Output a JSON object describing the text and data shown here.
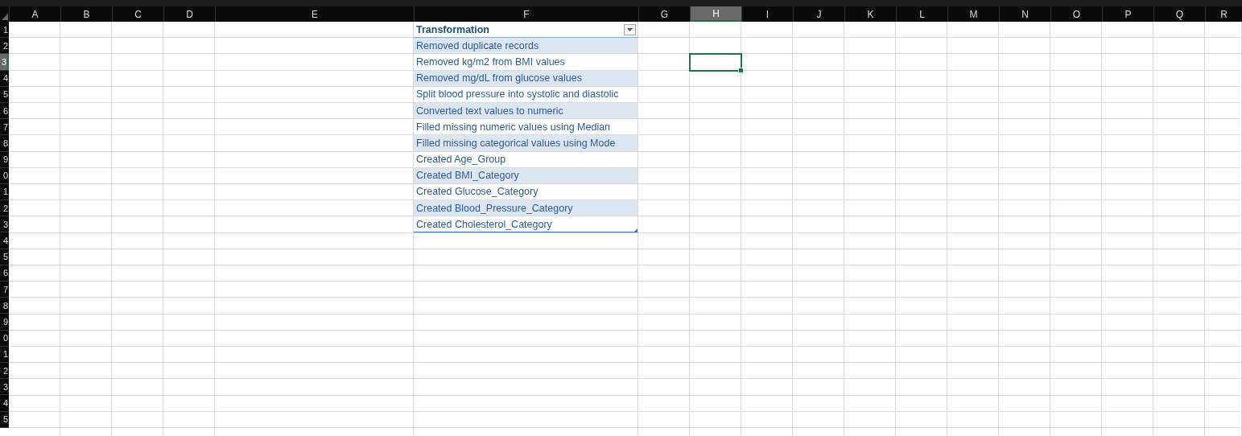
{
  "columns": [
    {
      "label": "A",
      "selected": false
    },
    {
      "label": "B",
      "selected": false
    },
    {
      "label": "C",
      "selected": false
    },
    {
      "label": "D",
      "selected": false
    },
    {
      "label": "E",
      "selected": false
    },
    {
      "label": "F",
      "selected": false
    },
    {
      "label": "G",
      "selected": false
    },
    {
      "label": "H",
      "selected": true
    },
    {
      "label": "I",
      "selected": false
    },
    {
      "label": "J",
      "selected": false
    },
    {
      "label": "K",
      "selected": false
    },
    {
      "label": "L",
      "selected": false
    },
    {
      "label": "M",
      "selected": false
    },
    {
      "label": "N",
      "selected": false
    },
    {
      "label": "O",
      "selected": false
    },
    {
      "label": "P",
      "selected": false
    },
    {
      "label": "Q",
      "selected": false
    },
    {
      "label": "R",
      "selected": false
    }
  ],
  "rows": [
    {
      "label": "1",
      "selected": false
    },
    {
      "label": "2",
      "selected": false
    },
    {
      "label": "3",
      "selected": true
    },
    {
      "label": "4",
      "selected": false
    },
    {
      "label": "5",
      "selected": false
    },
    {
      "label": "6",
      "selected": false
    },
    {
      "label": "7",
      "selected": false
    },
    {
      "label": "8",
      "selected": false
    },
    {
      "label": "9",
      "selected": false
    },
    {
      "label": "0",
      "selected": false
    },
    {
      "label": "1",
      "selected": false
    },
    {
      "label": "2",
      "selected": false
    },
    {
      "label": "3",
      "selected": false
    },
    {
      "label": "4",
      "selected": false
    },
    {
      "label": "5",
      "selected": false
    },
    {
      "label": "6",
      "selected": false
    },
    {
      "label": "7",
      "selected": false
    },
    {
      "label": "8",
      "selected": false
    },
    {
      "label": "9",
      "selected": false
    },
    {
      "label": "0",
      "selected": false
    },
    {
      "label": "1",
      "selected": false
    },
    {
      "label": "2",
      "selected": false
    },
    {
      "label": "3",
      "selected": false
    },
    {
      "label": "4",
      "selected": false
    },
    {
      "label": "5",
      "selected": false
    }
  ],
  "table": {
    "header": "Transformation",
    "filter_button": true,
    "entries": [
      {
        "text": "Removed duplicate records",
        "shaded": true
      },
      {
        "text": "Removed kg/m2 from BMI values",
        "shaded": false
      },
      {
        "text": "Removed mg/dL from glucose values",
        "shaded": true
      },
      {
        "text": "Split blood pressure into systolic and diastolic",
        "shaded": false
      },
      {
        "text": "Converted text values to numeric",
        "shaded": true
      },
      {
        "text": "Filled missing numeric values using Median",
        "shaded": false
      },
      {
        "text": "Filled missing categorical values using Mode",
        "shaded": true
      },
      {
        "text": "Created Age_Group",
        "shaded": false
      },
      {
        "text": "Created BMI_Category",
        "shaded": true
      },
      {
        "text": "Created Glucose_Category",
        "shaded": false
      },
      {
        "text": "Created Blood_Pressure_Category",
        "shaded": true
      },
      {
        "text": "Created Cholesterol_Category",
        "shaded": false
      }
    ]
  }
}
